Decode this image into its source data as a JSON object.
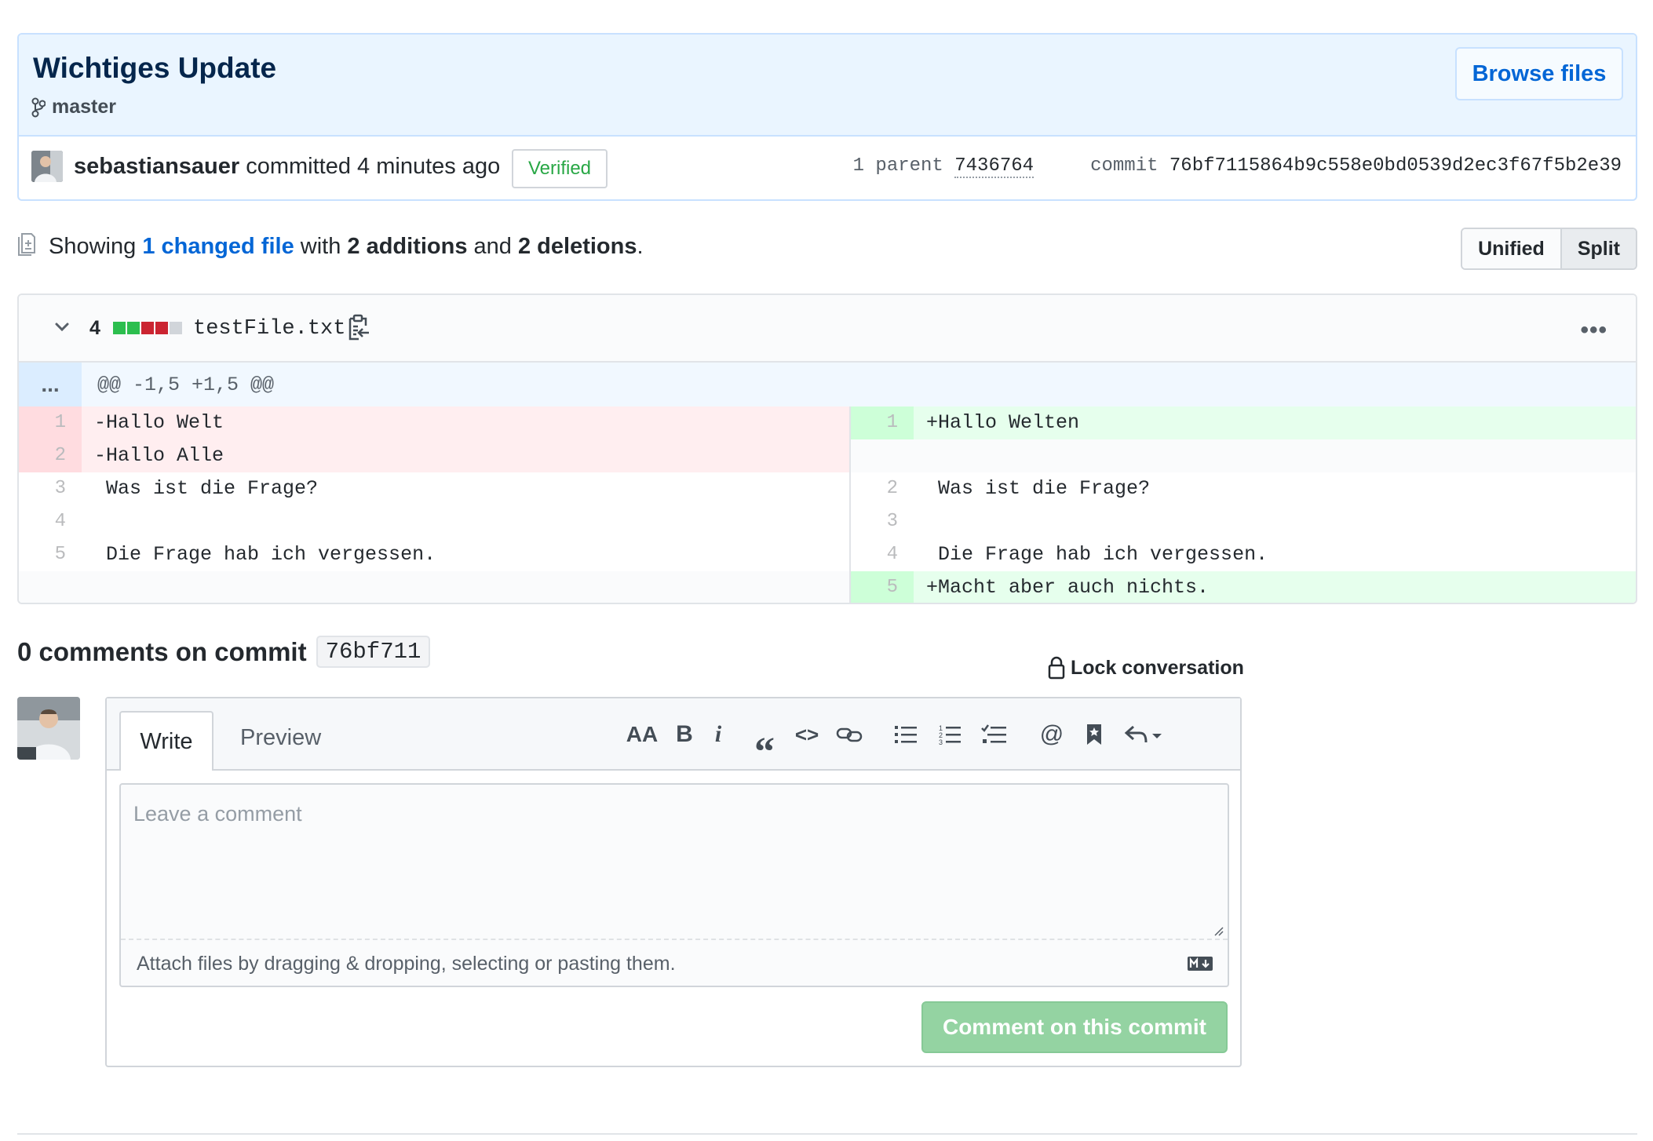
{
  "commit": {
    "title": "Wichtiges Update",
    "branch": "master",
    "browse_label": "Browse files",
    "author": "sebastiansauer",
    "action": "committed 4 minutes ago",
    "verified": "Verified",
    "parent_label": "1 parent",
    "parent_sha": "7436764",
    "commit_label": "commit",
    "commit_sha": "76bf7115864b9c558e0bd0539d2ec3f67f5b2e39"
  },
  "toc": {
    "showing": "Showing",
    "changed": "1 changed file",
    "with": "with",
    "additions": "2 additions",
    "and": "and",
    "deletions": "2 deletions",
    "period": ".",
    "view_unified": "Unified",
    "view_split": "Split"
  },
  "file": {
    "changes": "4",
    "name": "testFile.txt",
    "more": "•••",
    "diffstat_colors": [
      "#2cbe4e",
      "#2cbe4e",
      "#cb2431",
      "#cb2431",
      "#d1d5da"
    ],
    "hunk_expand": "...",
    "hunk_header": "@@ -1,5 +1,5 @@",
    "rows": [
      {
        "ln": "1",
        "lc": "-Hallo Welt",
        "lt": "del",
        "rn": "1",
        "rc": "+Hallo Welten",
        "rt": "add"
      },
      {
        "ln": "2",
        "lc": "-Hallo Alle",
        "lt": "del",
        "rn": "",
        "rc": "",
        "rt": "empty"
      },
      {
        "ln": "3",
        "lc": " Was ist die Frage?",
        "lt": "ctx",
        "rn": "2",
        "rc": " Was ist die Frage?",
        "rt": "ctx"
      },
      {
        "ln": "4",
        "lc": "",
        "lt": "ctx",
        "rn": "3",
        "rc": "",
        "rt": "ctx"
      },
      {
        "ln": "5",
        "lc": " Die Frage hab ich vergessen.",
        "lt": "ctx",
        "rn": "4",
        "rc": " Die Frage hab ich vergessen.",
        "rt": "ctx"
      },
      {
        "ln": "",
        "lc": "",
        "lt": "empty",
        "rn": "5",
        "rc": "+Macht aber auch nichts.",
        "rt": "add"
      }
    ]
  },
  "comments": {
    "title": "0 comments on commit",
    "sha": "76bf711",
    "lock": "Lock conversation"
  },
  "editor": {
    "tab_write": "Write",
    "tab_preview": "Preview",
    "placeholder": "Leave a comment",
    "attach": "Attach files by dragging & dropping, selecting or pasting them.",
    "submit": "Comment on this commit",
    "tools": {
      "heading": "AA",
      "bold": "B",
      "italic": "i",
      "quote": "“",
      "code": "<>",
      "mention": "@"
    }
  }
}
